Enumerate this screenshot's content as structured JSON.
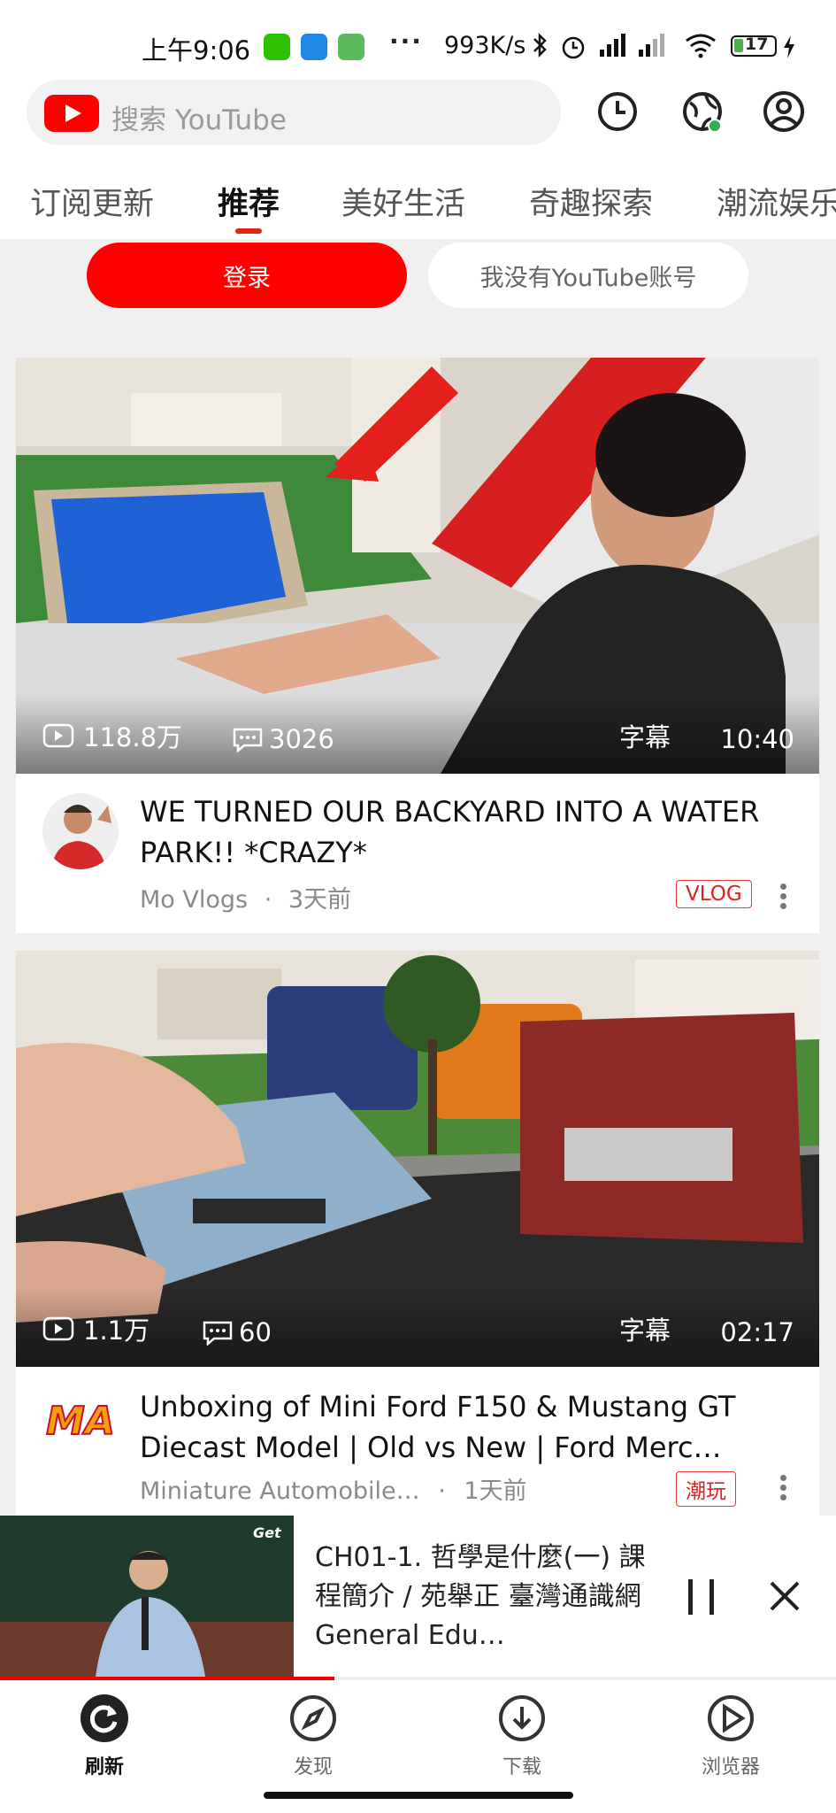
{
  "status_bar": {
    "time": "上午9:06",
    "net_speed": "993K/s",
    "battery": "17"
  },
  "search": {
    "placeholder": "搜索 YouTube"
  },
  "tabs": [
    {
      "label": "订阅更新"
    },
    {
      "label": "推荐",
      "active": true
    },
    {
      "label": "美好生活"
    },
    {
      "label": "奇趣探索"
    },
    {
      "label": "潮流娱乐"
    }
  ],
  "auth": {
    "login_label": "登录",
    "no_account_label": "我没有YouTube账号"
  },
  "videos": [
    {
      "views": "118.8万",
      "comments": "3026",
      "cc": "字幕",
      "duration": "10:40",
      "title": "WE TURNED OUR BACKYARD INTO A WATER PARK!! *CRAZY*",
      "channel": "Mo Vlogs",
      "separator": "·",
      "age": "3天前",
      "tag": "VLOG"
    },
    {
      "views": "1.1万",
      "comments": "60",
      "cc": "字幕",
      "duration": "02:17",
      "title": "Unboxing of Mini Ford F150 & Mustang GT Diecast Model | Old vs New | Ford Merc…",
      "channel": "Miniature Automobile…",
      "separator": "·",
      "age": "1天前",
      "tag": "潮玩",
      "channel_logo_text": "MA"
    }
  ],
  "mini_player": {
    "title": "CH01-1. 哲學是什麼(一) 課程簡介 / 苑舉正 臺灣通識網General Edu…",
    "logo_text": "Get"
  },
  "nav": [
    {
      "label": "刷新",
      "icon": "refresh-icon",
      "active": true
    },
    {
      "label": "发现",
      "icon": "compass-icon"
    },
    {
      "label": "下载",
      "icon": "download-icon"
    },
    {
      "label": "浏览器",
      "icon": "browser-icon"
    }
  ],
  "colors": {
    "accent": "#FF0000",
    "badge": "#DD2222"
  }
}
